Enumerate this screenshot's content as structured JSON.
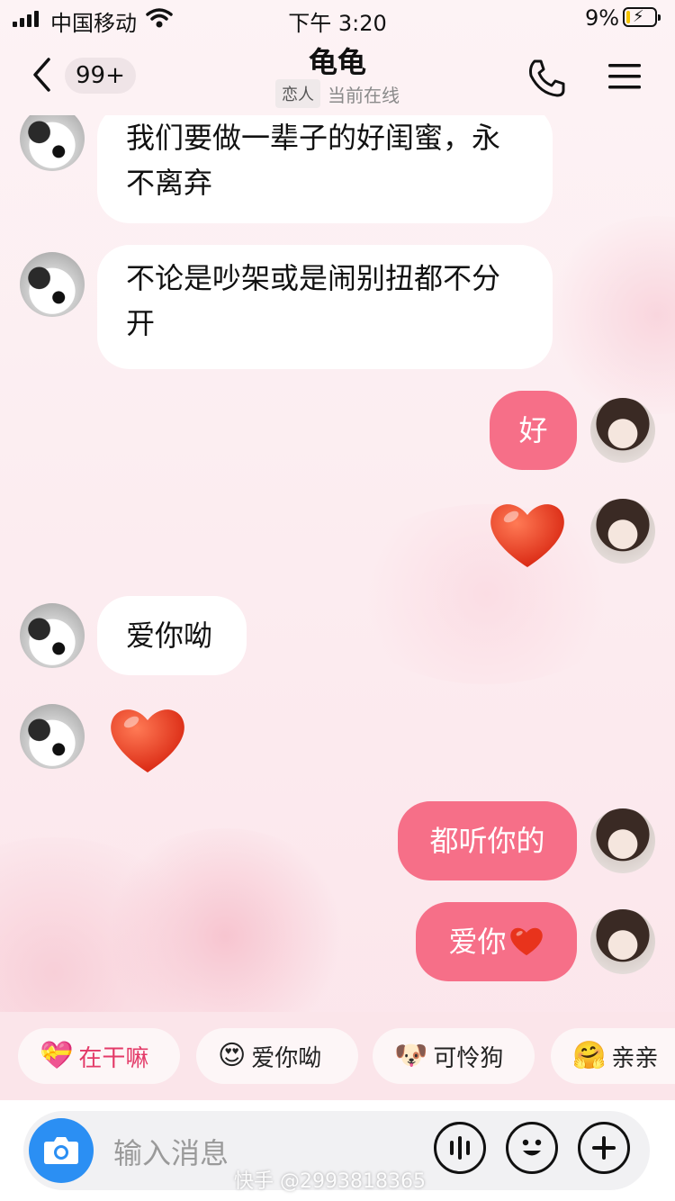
{
  "status_bar": {
    "carrier": "中国移动",
    "time": "下午 3:20",
    "battery_percent": "9%",
    "battery_level": 0.09
  },
  "header": {
    "unread_count": "99+",
    "title": "龟龟",
    "relation_tag": "恋人",
    "online_status": "当前在线"
  },
  "messages": [
    {
      "side": "in",
      "text": "我们要做一辈子的好闺蜜，永不离弃"
    },
    {
      "side": "in",
      "text": "不论是吵架或是闹别扭都不分开"
    },
    {
      "side": "out",
      "text": "好"
    },
    {
      "side": "out",
      "type": "sticker",
      "icon": "red-heart-icon"
    },
    {
      "side": "in",
      "text": "爱你呦"
    },
    {
      "side": "in",
      "type": "sticker",
      "icon": "red-heart-icon"
    },
    {
      "side": "out",
      "text": "都听你的"
    },
    {
      "side": "out",
      "text": "爱你",
      "trailing_icon": "red-heart-icon"
    }
  ],
  "quick_replies": [
    {
      "icon": "heart-gift-icon",
      "emoji": "💝",
      "label": "在干嘛",
      "color": "#e33a68"
    },
    {
      "icon": "heart-eyes-icon",
      "emoji": "😍",
      "label": "爱你呦"
    },
    {
      "icon": "puppy-icon",
      "emoji": "🐶",
      "label": "可怜狗"
    },
    {
      "icon": "hug-icon",
      "emoji": "🤗",
      "label": "亲亲"
    }
  ],
  "input": {
    "placeholder": "输入消息"
  },
  "watermark": "快手 @2993818365",
  "colors": {
    "outgoing_bubble": "#f66f88",
    "camera_button": "#2b8ff3",
    "heart": "#e8331c"
  }
}
